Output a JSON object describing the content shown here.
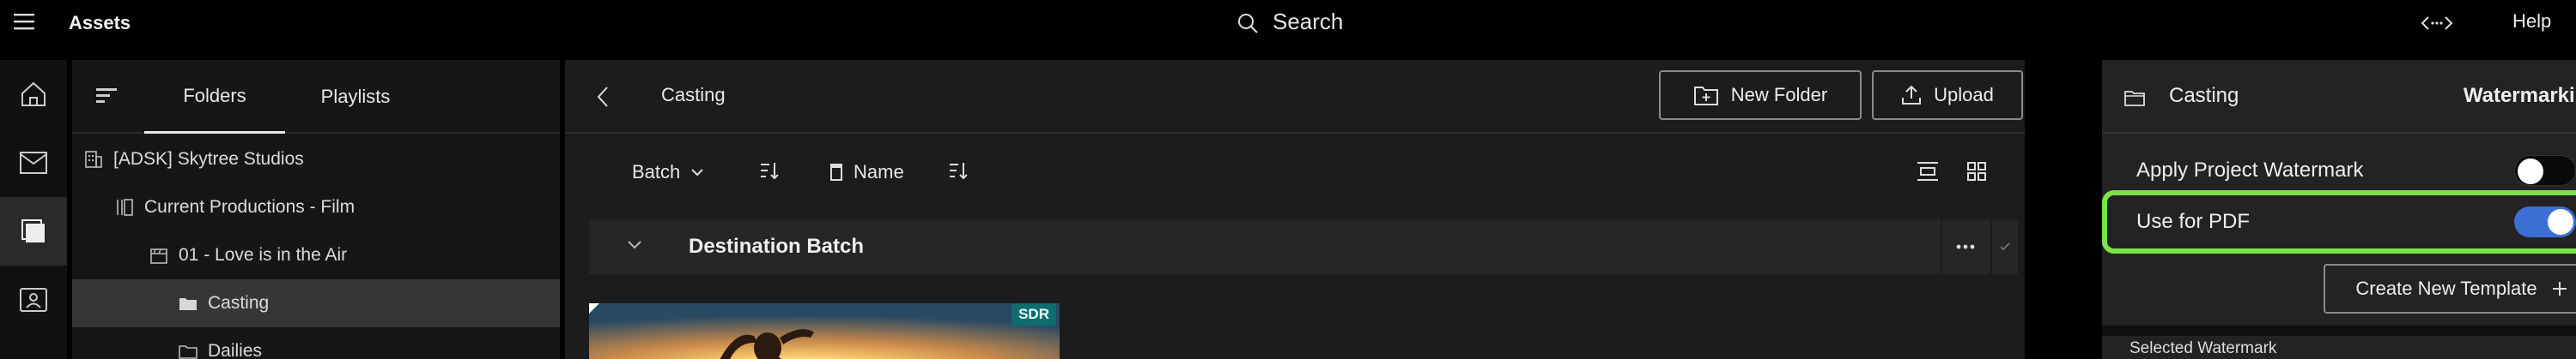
{
  "header": {
    "app_title": "Assets",
    "search_label": "Search",
    "help_label": "Help"
  },
  "folders_panel": {
    "tabs": [
      {
        "label": "Folders",
        "active": true
      },
      {
        "label": "Playlists",
        "active": false
      }
    ],
    "tree": [
      {
        "label": "[ADSK] Skytree Studios",
        "icon": "building-icon",
        "depth": 0
      },
      {
        "label": "Current Productions - Film",
        "icon": "film-strip-icon",
        "depth": 1
      },
      {
        "label": "01 - Love is in the Air",
        "icon": "clapper-icon",
        "depth": 2
      },
      {
        "label": "Casting",
        "icon": "folder-icon",
        "depth": 3,
        "selected": true
      },
      {
        "label": "Dailies",
        "icon": "folder-outline-icon",
        "depth": 3
      }
    ]
  },
  "main": {
    "title": "Casting",
    "new_folder_label": "New Folder",
    "upload_label": "Upload",
    "toolbar": {
      "batch_label": "Batch",
      "name_label": "Name"
    },
    "batch_group": {
      "name": "Destination Batch",
      "more_label": "..."
    },
    "thumbnail": {
      "badge": "SDR"
    }
  },
  "right_panel": {
    "folder_title": "Casting",
    "section_title": "Watermarking",
    "settings": [
      {
        "label": "Apply Project Watermark",
        "enabled": false
      },
      {
        "label": "Use for PDF",
        "enabled": true
      }
    ],
    "create_template_label": "Create New Template",
    "selected_watermark_label": "Selected Watermark"
  },
  "colors": {
    "toggle_on": "#3b6fd4",
    "highlight": "#7ce24a",
    "badge_sdr": "#0f6d6d"
  }
}
